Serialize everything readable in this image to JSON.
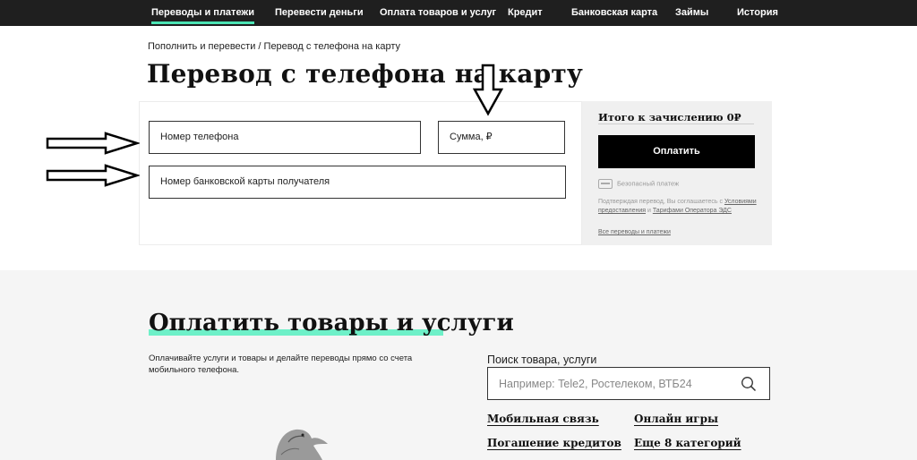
{
  "nav": {
    "items": [
      {
        "label": "Переводы и платежи",
        "active": true
      },
      {
        "label": "Перевести деньги"
      },
      {
        "label": "Оплата товаров и услуг"
      },
      {
        "label": "Кредит"
      },
      {
        "label": "Банковская карта"
      },
      {
        "label": "Займы"
      },
      {
        "label": "История"
      }
    ]
  },
  "breadcrumb": {
    "parent": "Пополнить и перевести",
    "separator": " / ",
    "current": "Перевод с телефона на карту"
  },
  "page_title": "Перевод с телефона на карту",
  "form": {
    "phone_placeholder": "Номер телефона",
    "amount_placeholder": "Сумма, ₽",
    "card_placeholder": "Номер банковской карты получателя"
  },
  "summary": {
    "total_label": "Итого к зачислению 0₽",
    "pay_button": "Оплатить",
    "secure_text": "Безопасный платеж",
    "terms_prefix": "Подтверждая перевод, Вы соглашаетесь с ",
    "terms_link1": "Условиями предоставления",
    "terms_and": " и ",
    "terms_link2": "Тарифами Оператора ЭДС",
    "all_link": "Все переводы и платежи"
  },
  "services": {
    "title": "Оплатить товары и услуги",
    "description": "Оплачивайте услуги и товары и делайте переводы прямо со счета мобильного телефона.",
    "search_label": "Поиск товара, услуги",
    "search_placeholder": "Например: Tele2, Ростелеком, ВТБ24",
    "categories": [
      "Мобильная связь",
      "Онлайн игры",
      "Погашение кредитов",
      "Еще 8 категорий"
    ]
  },
  "colors": {
    "nav_bg": "#1f1f1f",
    "accent": "#4be4b4",
    "button_bg": "#000000"
  }
}
